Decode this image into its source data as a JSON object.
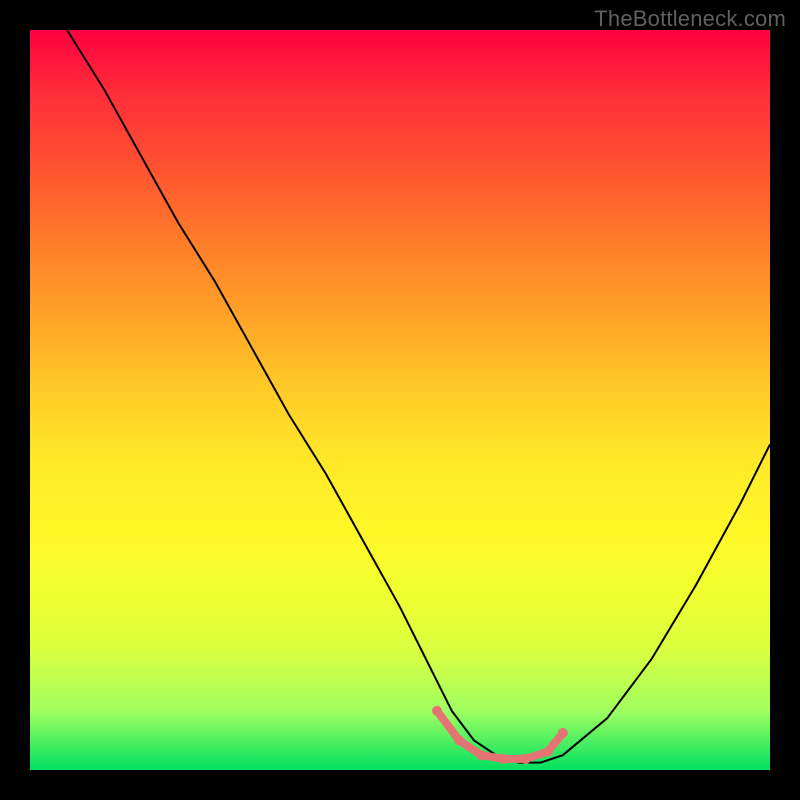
{
  "watermark": "TheBottleneck.com",
  "chart_data": {
    "type": "line",
    "title": "",
    "xlabel": "",
    "ylabel": "",
    "xlim": [
      0,
      100
    ],
    "ylim": [
      0,
      100
    ],
    "series": [
      {
        "name": "curve",
        "x": [
          5,
          10,
          15,
          20,
          25,
          30,
          35,
          40,
          45,
          50,
          55,
          57,
          60,
          63,
          66,
          69,
          72,
          78,
          84,
          90,
          96,
          100
        ],
        "y": [
          100,
          92,
          83,
          74,
          66,
          57,
          48,
          40,
          31,
          22,
          12,
          8,
          4,
          2,
          1,
          1,
          2,
          7,
          15,
          25,
          36,
          44
        ]
      }
    ],
    "highlight_segment": {
      "name": "bottom-marker",
      "color": "#e57373",
      "x": [
        55,
        58,
        61,
        64,
        67,
        70,
        72
      ],
      "y": [
        8,
        4,
        2,
        1.5,
        1.5,
        2.5,
        5
      ]
    },
    "background_gradient": {
      "top": "#ff0040",
      "middle": "#ffe828",
      "bottom": "#00e060"
    }
  }
}
